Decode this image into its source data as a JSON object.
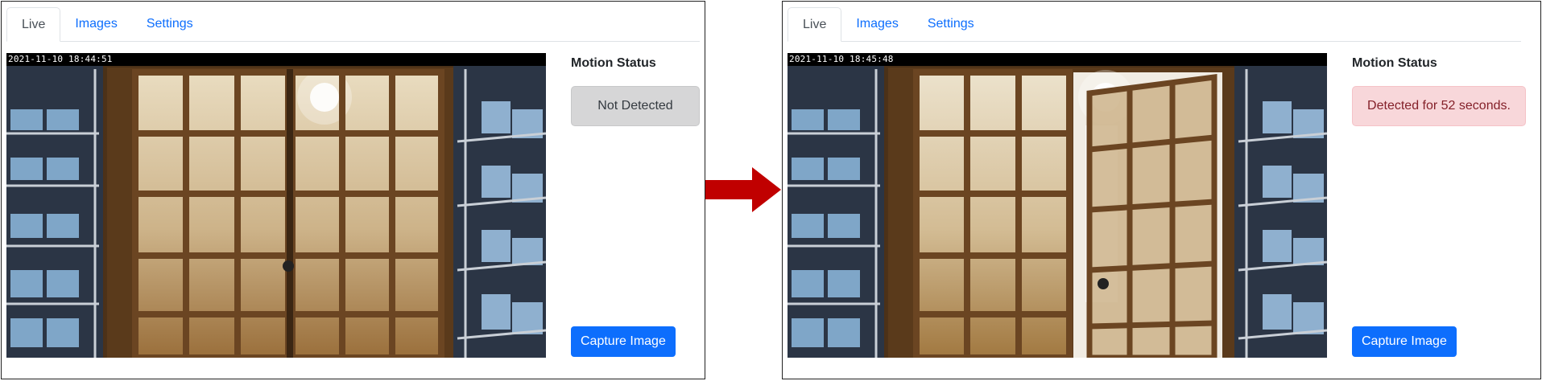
{
  "panels": [
    {
      "tabs": [
        "Live",
        "Images",
        "Settings"
      ],
      "active_tab": "Live",
      "camera_timestamp": "2021-11-10  18:44:51",
      "status_title": "Motion Status",
      "status_text": "Not Detected",
      "status_state": "not-detected",
      "door_state": "closed",
      "capture_label": "Capture Image"
    },
    {
      "tabs": [
        "Live",
        "Images",
        "Settings"
      ],
      "active_tab": "Live",
      "camera_timestamp": "2021-11-10  18:45:48",
      "status_title": "Motion Status",
      "status_text": "Detected for 52 seconds.",
      "status_state": "detected",
      "door_state": "open",
      "capture_label": "Capture Image"
    }
  ],
  "transition_arrow": {
    "icon": "right-arrow-icon",
    "color": "#c00000"
  },
  "colors": {
    "accent": "#0d6efd",
    "status_none_bg": "#d6d6d7",
    "status_detected_bg": "#f8d7da",
    "status_detected_text": "#842029"
  }
}
